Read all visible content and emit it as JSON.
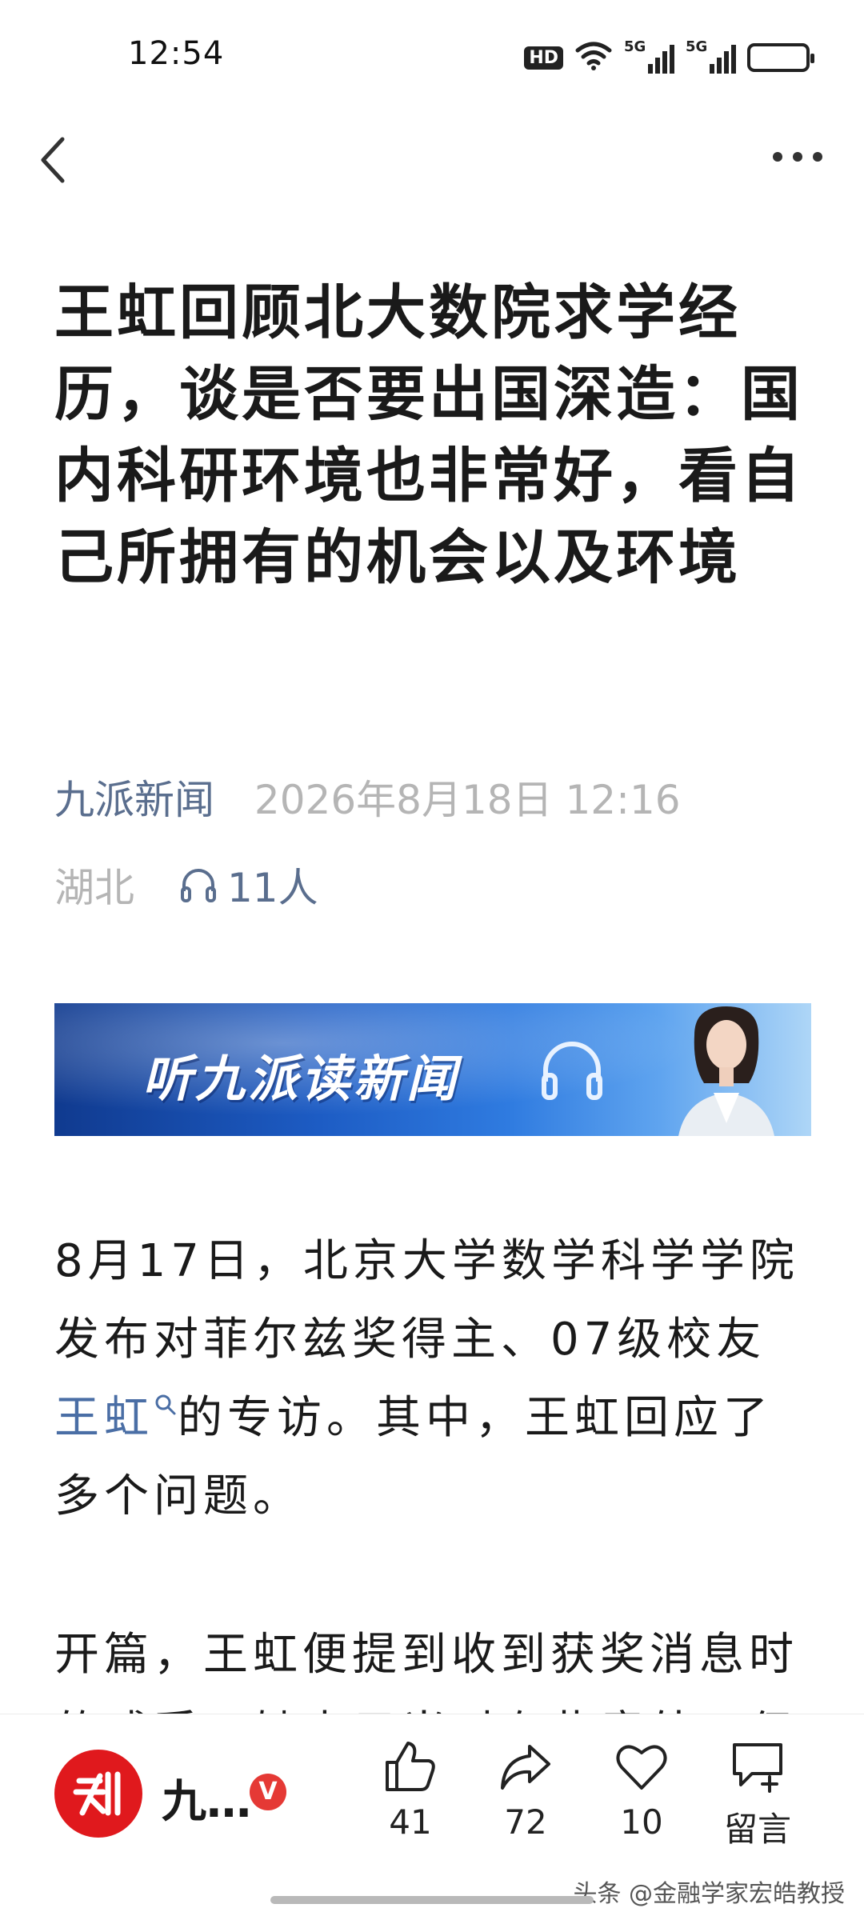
{
  "status_bar": {
    "time": "12:54",
    "hd_label": "HD",
    "signal_1_label": "5G",
    "signal_2_label": "5G",
    "battery_level": 1.0
  },
  "article": {
    "title": "王虹回顾北大数院求学经历，谈是否要出国深造：国内科研环境也非常好，看自己所拥有的机会以及环境",
    "source": "九派新闻",
    "date": "2026年8月18日 12:16",
    "location": "湖北",
    "listen_count": "11人",
    "banner_text": "听九派读新闻",
    "p1_before": "8月17日，北京大学数学科学学院发布对菲尔兹奖得主、07级校友",
    "p1_link": "王虹",
    "p1_after": "的专访。其中，王虹回应了多个问题。",
    "p2": "开篇，王虹便提到收到获奖消息时的感受，她表示当时有些意外，但也很开心。"
  },
  "bottom_bar": {
    "account_name": "九…",
    "verified_badge": "V",
    "like_count": "41",
    "share_count": "72",
    "favorite_count": "10",
    "comment_label": "留言"
  },
  "watermark": "头条 @金融学家宏皓教授",
  "colors": {
    "link": "#4a6ea5",
    "source": "#5a6e8e",
    "avatar_red": "#e0191d",
    "banner_blue": "#1d5cc4"
  }
}
